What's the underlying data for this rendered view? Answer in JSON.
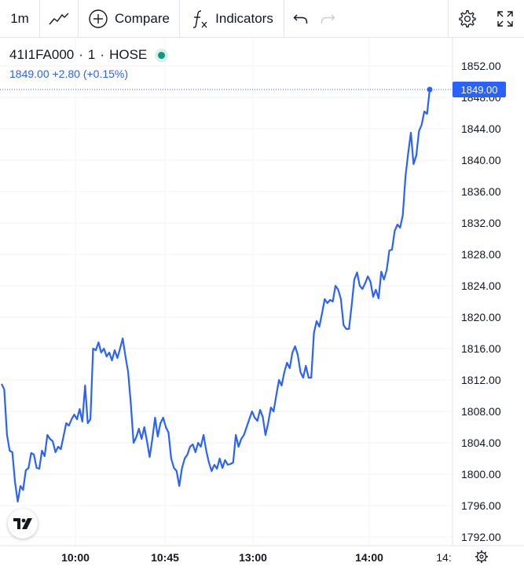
{
  "toolbar": {
    "interval": "1m",
    "compare_label": "Compare",
    "indicators_label": "Indicators"
  },
  "legend": {
    "symbol": "41I1FA000",
    "interval": "1",
    "exchange": "HOSE",
    "last": "1849.00",
    "change": "+2.80",
    "change_pct": "(+0.15%)"
  },
  "colors": {
    "line": "#2962ff",
    "grid": "#f0f3fa",
    "axis_text": "#131722",
    "price_label_bg": "#2962ff",
    "status_dot": "#089981"
  },
  "chart_data": {
    "type": "line",
    "title": "41I1FA000 · 1 · HOSE",
    "y_ticks": [
      "1852.00",
      "1848.00",
      "1844.00",
      "1840.00",
      "1836.00",
      "1832.00",
      "1828.00",
      "1824.00",
      "1820.00",
      "1816.00",
      "1812.00",
      "1808.00",
      "1804.00",
      "1800.00",
      "1796.00",
      "1792.00"
    ],
    "ylim": [
      1792,
      1852
    ],
    "x_ticks": [
      "10:00",
      "10:45",
      "13:00",
      "14:00",
      "14:"
    ],
    "last_price_label": "1849.00",
    "series": [
      {
        "values": [
          1811.5,
          1810.8,
          1805,
          1803,
          1802.8,
          1799,
          1796.5,
          1798.5,
          1798,
          1800.5,
          1800.8,
          1802.7,
          1802.5,
          1800.8,
          1800.7,
          1803,
          1802.3,
          1805,
          1804.5,
          1804.2,
          1802.8,
          1803.5,
          1803.2,
          1804.8,
          1806.5,
          1806.2,
          1807,
          1807.6,
          1807,
          1808.3,
          1806.7,
          1811.3,
          1806.5,
          1807,
          1816,
          1815.8,
          1816.8,
          1815.5,
          1816,
          1815,
          1815.5,
          1814.5,
          1815.8,
          1814.8,
          1816,
          1817.3,
          1815,
          1813,
          1809,
          1804,
          1804.7,
          1805.8,
          1804.5,
          1806,
          1804.2,
          1802.2,
          1804.5,
          1807.2,
          1804.8,
          1806.5,
          1807.2,
          1806,
          1805.3,
          1802,
          1800.8,
          1800.4,
          1798.5,
          1800.8,
          1802,
          1802.5,
          1803.5,
          1803.8,
          1802.8,
          1804,
          1803.5,
          1805,
          1803,
          1801.5,
          1800.4,
          1801.2,
          1800.7,
          1802,
          1800.8,
          1801.8,
          1801.2,
          1801.3,
          1801.5,
          1805,
          1803.5,
          1804.5,
          1805,
          1806,
          1807,
          1808,
          1807.2,
          1806.8,
          1808.2,
          1807.3,
          1805,
          1806.5,
          1808.5,
          1808,
          1810,
          1812,
          1811.3,
          1813,
          1814.2,
          1813.5,
          1815.5,
          1816.3,
          1815.2,
          1813,
          1812.3,
          1813.8,
          1812.3,
          1812.3,
          1818,
          1819.5,
          1818.8,
          1820.5,
          1822.3,
          1821.8,
          1822.2,
          1822,
          1824,
          1823.5,
          1822.3,
          1819,
          1818.5,
          1818.5,
          1821.5,
          1824.8,
          1825.7,
          1824,
          1823.6,
          1824.3,
          1825.2,
          1824.5,
          1822.6,
          1823.5,
          1822.4,
          1825.8,
          1824.8,
          1826,
          1828.5,
          1828.6,
          1831,
          1831.8,
          1831.4,
          1833,
          1838,
          1840.9,
          1843.5,
          1839.5,
          1840.6,
          1843.7,
          1844.5,
          1846.2,
          1845.9,
          1849
        ]
      }
    ],
    "grid": true,
    "legend": "top-left"
  }
}
